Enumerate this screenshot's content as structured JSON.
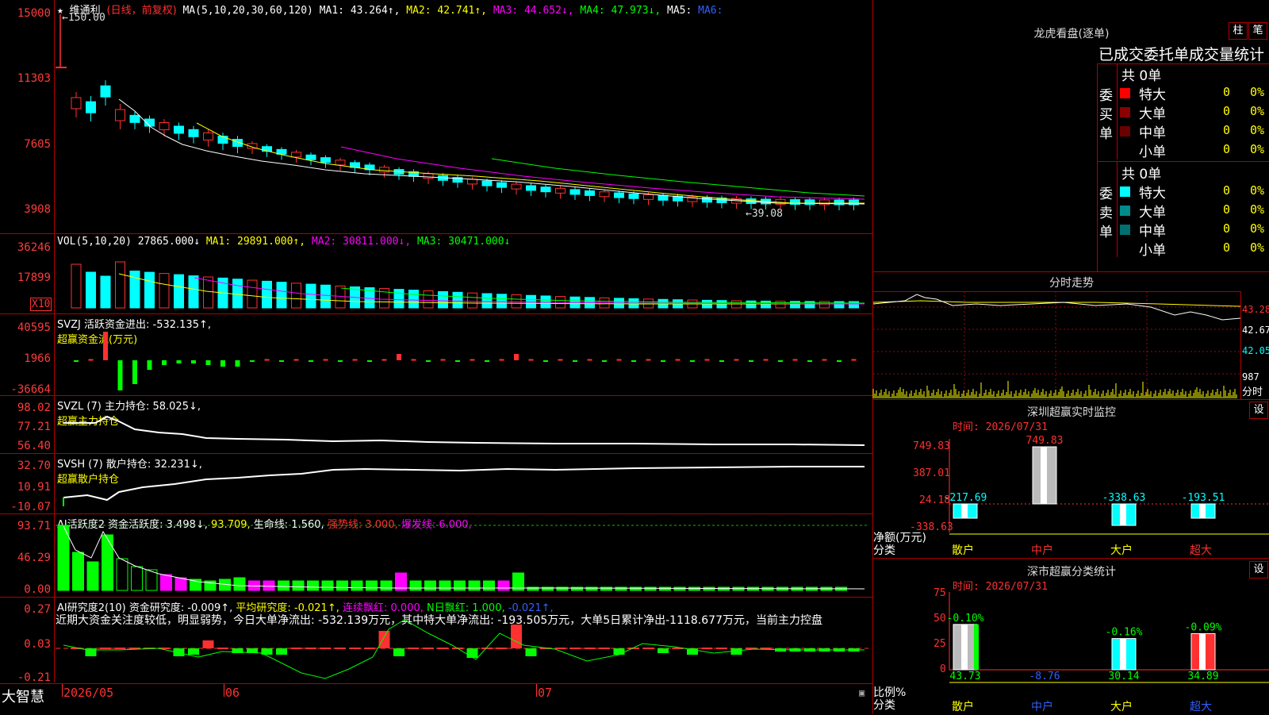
{
  "app": {
    "brand": "大智慧"
  },
  "price_pane": {
    "title": "维通利",
    "period": "(日线，前复权)",
    "ma_params": "MA(5,10,20,30,60,120)",
    "ma1": "MA1: 43.264↑,",
    "ma2": "MA2: 42.741↑,",
    "ma3": "MA3: 44.652↓,",
    "ma4": "MA4: 47.973↓,",
    "ma5": "MA5:",
    "ma6": "MA6:",
    "y_labels": [
      "15000",
      "11303",
      "7605",
      "3908"
    ],
    "high_mark": "←150.00",
    "low_mark": "←39.08"
  },
  "vol_pane": {
    "params": "VOL(5,10,20)",
    "value": "27865.000↓",
    "ma1": "MA1: 29891.000↑,",
    "ma2": "MA2: 30811.000↓,",
    "ma3": "MA3: 30471.000↓",
    "y_labels": [
      "36246",
      "17899"
    ],
    "unit": "X10"
  },
  "svzj_pane": {
    "label": "SVZJ  活跃资金进出: -532.135↑,",
    "sub": "超赢资金流(万元)",
    "y_labels": [
      "40595",
      "1966",
      "-36664"
    ]
  },
  "svzl_pane": {
    "label": "SVZL (7) 主力持仓: 58.025↓,",
    "sub": "超赢主力持仓",
    "y_labels": [
      "98.02",
      "77.21",
      "56.40"
    ]
  },
  "svsh_pane": {
    "label": "SVSH (7) 散户持仓: 32.231↓,",
    "sub": "超赢散户持仓",
    "y_labels": [
      "32.70",
      "10.91",
      "-10.07"
    ]
  },
  "ai_active_pane": {
    "label1": "AI活跃度2 资金活跃度: 3.498↓,",
    "label2": "93.709,",
    "label3": "生命线: 1.560,",
    "label4": "强势线: 3.000,",
    "label5": "爆发线: 6.000,",
    "y_labels": [
      "93.71",
      "46.29",
      "0.00"
    ]
  },
  "ai_research_pane": {
    "label1": "AI研究度2(10) 资金研究度: -0.009↑,",
    "label2": "平均研究度: -0.021↑,",
    "label3": "连续飘红: 0.000,",
    "label4": "N日飘红: 1.000,",
    "label5": "-0.021↑,",
    "comment": "近期大资金关注度较低，明显弱势，今日大单净流出: -532.139万元，其中特大单净流出: -193.505万元，大单5日累计净出-1118.677万元，当前主力控盘",
    "y_labels": [
      "0.27",
      "0.03",
      "-0.21"
    ]
  },
  "x_axis": {
    "labels": [
      "2026/05",
      "06",
      "07"
    ]
  },
  "dragon_tiger": {
    "title": "龙虎看盘(逐单)",
    "btn_bar": "柱",
    "btn_pen": "笔",
    "table_title": "已成交委托单成交量统计",
    "buy_group": "委买单",
    "sell_group": "委卖单",
    "buy_total": "共 0单",
    "sell_total": "共 0单",
    "buy_rows": [
      {
        "name": "特大",
        "count": "0",
        "pct": "0%",
        "color": "#ff0000"
      },
      {
        "name": "大单",
        "count": "0",
        "pct": "0%",
        "color": "#8b0000"
      },
      {
        "name": "中单",
        "count": "0",
        "pct": "0%",
        "color": "#6b0000"
      },
      {
        "name": "小单",
        "count": "0",
        "pct": "0%",
        "color": "#000000"
      }
    ],
    "sell_rows": [
      {
        "name": "特大",
        "count": "0",
        "pct": "0%",
        "color": "#00ffff"
      },
      {
        "name": "大单",
        "count": "0",
        "pct": "0%",
        "color": "#008b8b"
      },
      {
        "name": "中单",
        "count": "0",
        "pct": "0%",
        "color": "#007070"
      },
      {
        "name": "小单",
        "count": "0",
        "pct": "0%",
        "color": "#000000"
      }
    ]
  },
  "intraday": {
    "title": "分时走势",
    "y_labels": [
      "43.28",
      "42.67",
      "42.05"
    ],
    "vol_label": "987",
    "time_label": "分时"
  },
  "monitor": {
    "title": "深圳超赢实时监控",
    "btn": "设",
    "time": "时间: 2026/07/31",
    "y_labels": [
      "749.83",
      "387.01",
      "24.18",
      "-338.63"
    ],
    "net_label": "净额(万元)",
    "cat_label": "分类",
    "categories": [
      "散户",
      "中户",
      "大户",
      "超大"
    ],
    "values": [
      -217.69,
      749.83,
      -338.63,
      -193.51
    ],
    "value_labels": [
      "-217.69",
      "749.83",
      "-338.63",
      "-193.51"
    ]
  },
  "classify": {
    "title": "深市超赢分类统计",
    "btn": "设",
    "time": "时间: 2026/07/31",
    "y_labels": [
      "75",
      "50",
      "25",
      "0"
    ],
    "ratio_label": "比例%",
    "cat_label": "分类",
    "categories": [
      "散户",
      "中户",
      "大户",
      "超大"
    ],
    "values": [
      43.73,
      -8.76,
      30.14,
      34.89
    ],
    "top_labels": [
      "-0.10%",
      "",
      "-0.16%",
      "-0.09%"
    ],
    "bottom_labels": [
      "43.73",
      "-8.76",
      "30.14",
      "34.89"
    ]
  },
  "colors": {
    "up": "#ff3030",
    "down": "#00ffff",
    "grid": "#b00000",
    "green": "#00ff00",
    "magenta": "#ff00ff",
    "yellow": "#ffff00"
  }
}
